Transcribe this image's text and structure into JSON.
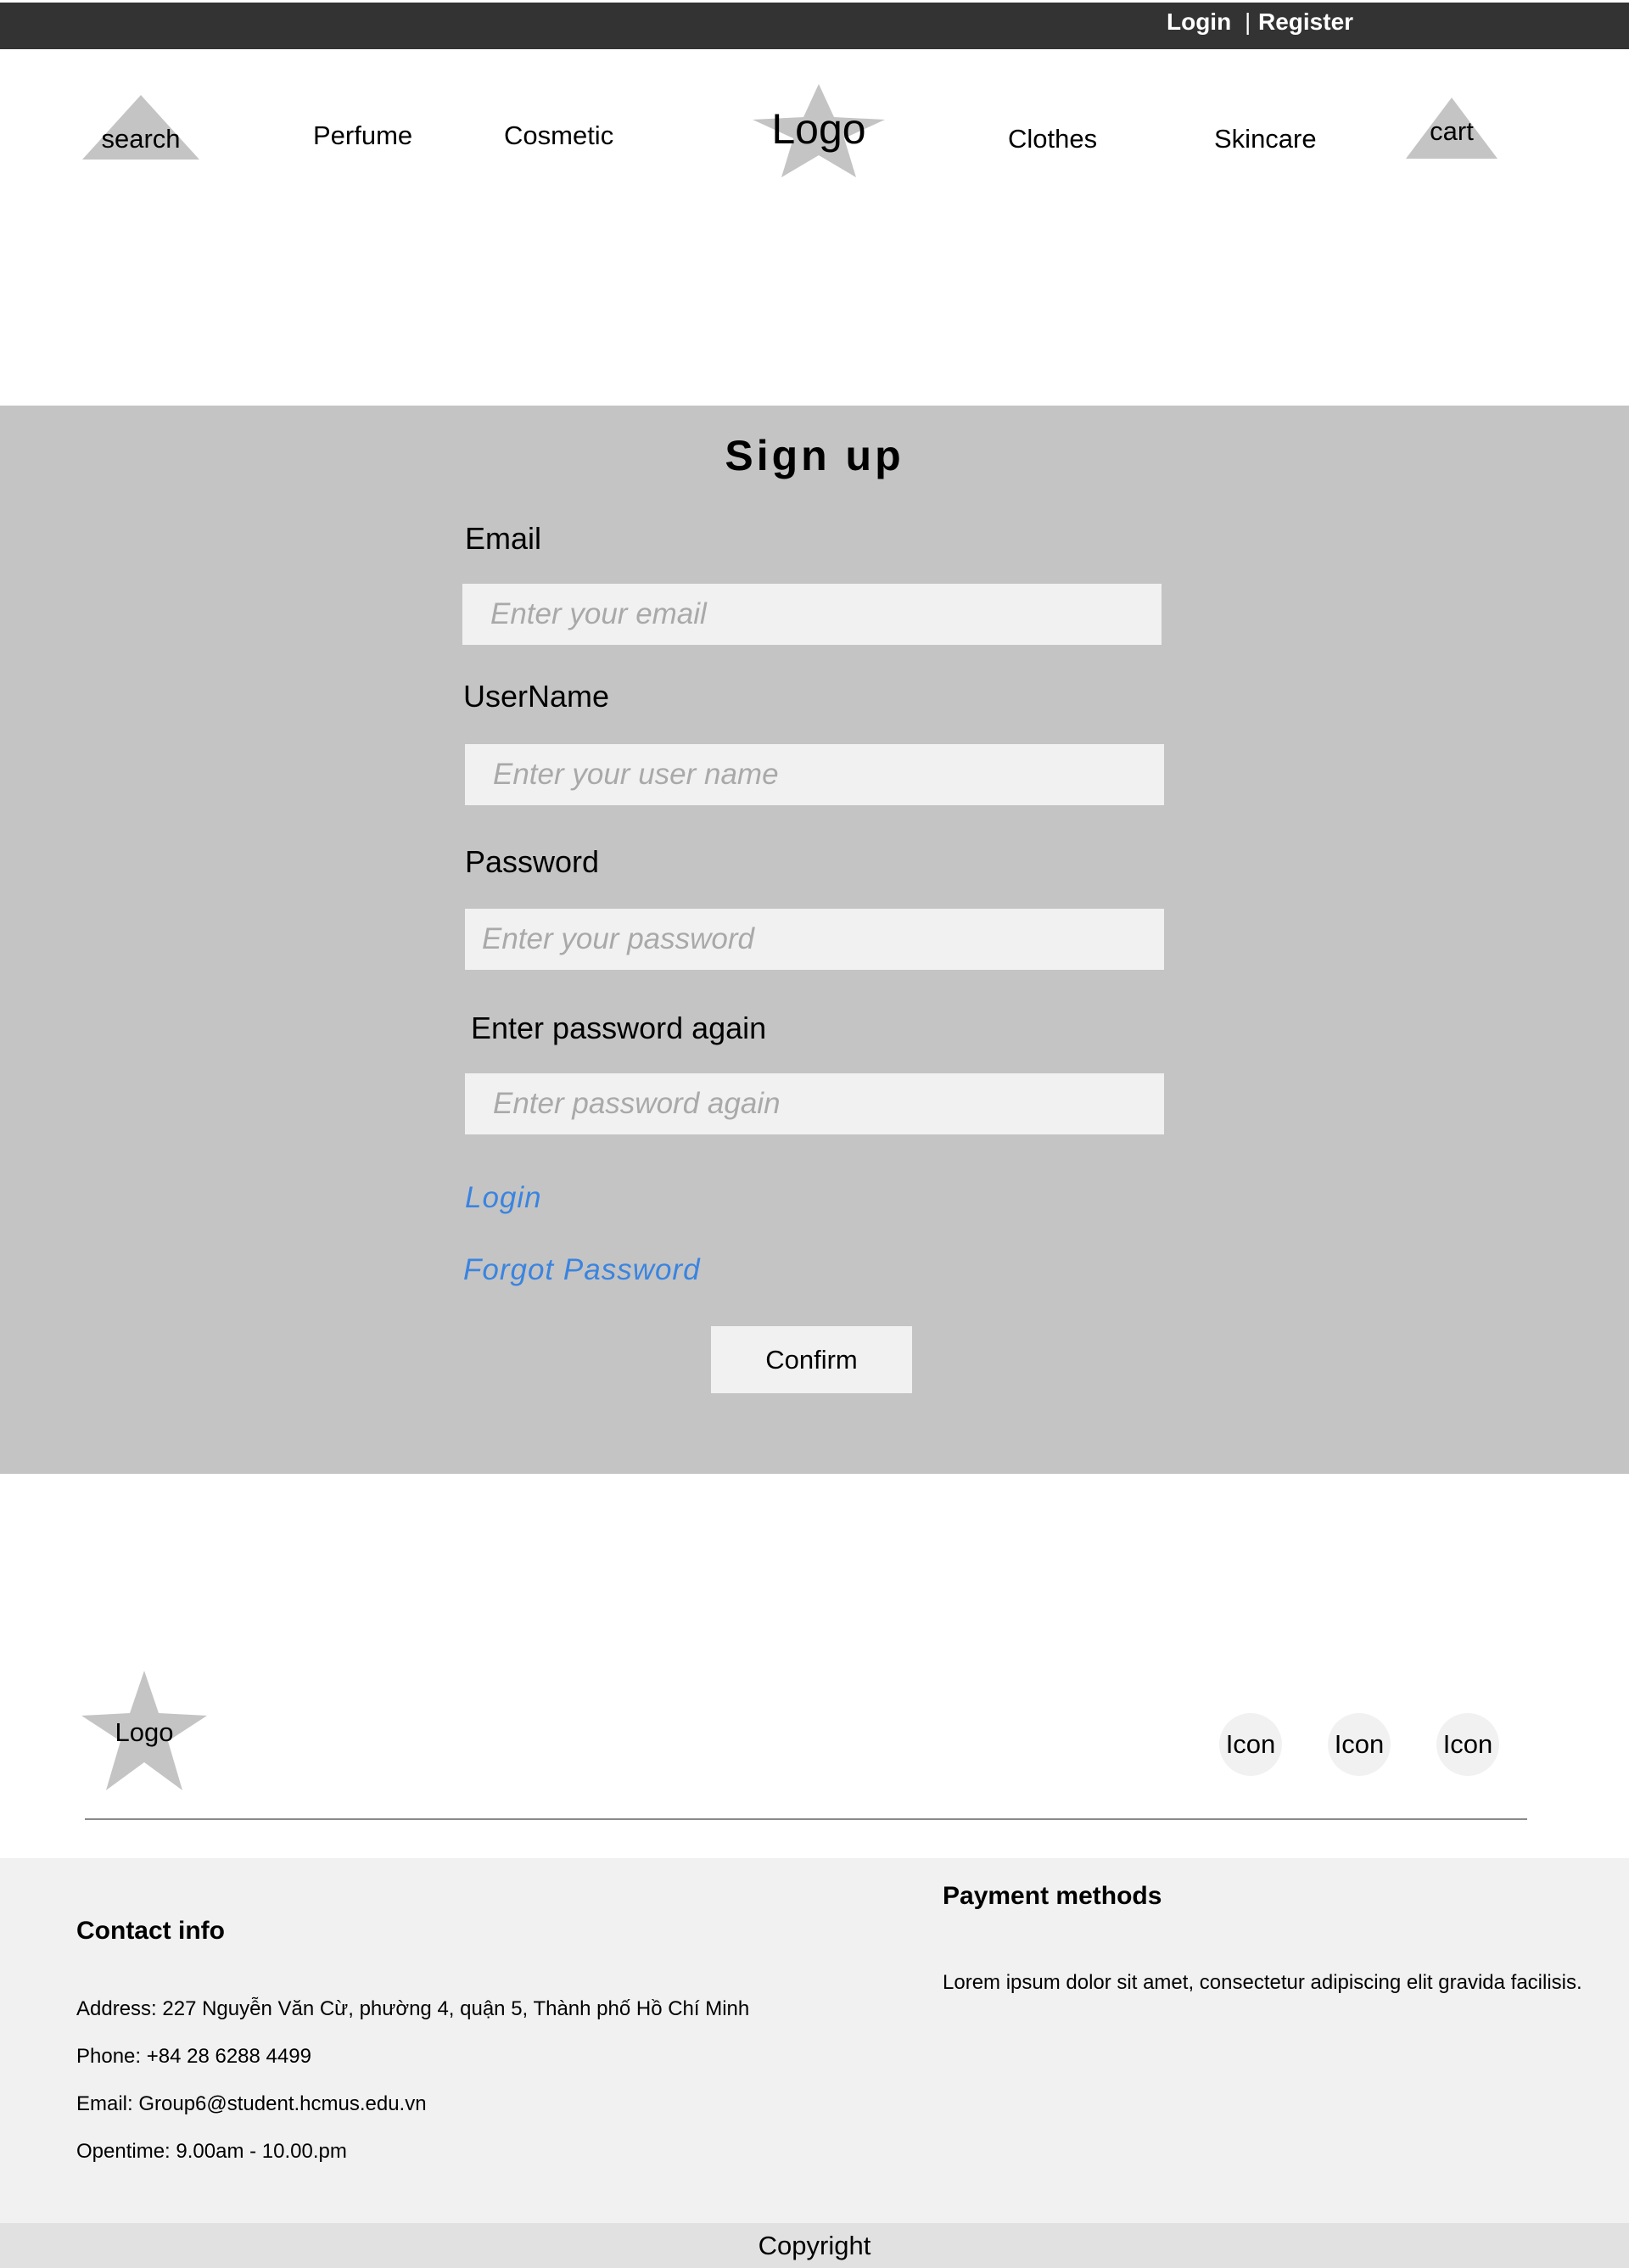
{
  "topbar": {
    "login": "Login",
    "separator": "|",
    "register": "Register"
  },
  "nav": {
    "search": "search",
    "items": [
      "Perfume",
      "Cosmetic",
      "Clothes",
      "Skincare"
    ],
    "logo": "Logo",
    "cart": "cart"
  },
  "signup": {
    "title": "Sign up",
    "fields": [
      {
        "label": "Email",
        "placeholder": "Enter your email"
      },
      {
        "label": "UserName",
        "placeholder": "Enter your user name"
      },
      {
        "label": "Password",
        "placeholder": "Enter your password"
      },
      {
        "label": "Enter password again",
        "placeholder": "Enter password again"
      }
    ],
    "login_link": "Login",
    "forgot_link": "Forgot Password",
    "confirm": "Confirm"
  },
  "footer": {
    "logo": "Logo",
    "icons": [
      "Icon",
      "Icon",
      "Icon"
    ],
    "contact": {
      "heading": "Contact info",
      "address": "Address: 227 Nguyễn Văn Cừ, phường 4, quận 5, Thành phố Hồ Chí Minh",
      "phone": "Phone: +84 28 6288 4499",
      "email": "Email: Group6@student.hcmus.edu.vn",
      "opentime": "Opentime: 9.00am - 10.00.pm"
    },
    "payment": {
      "heading": "Payment methods",
      "text": "Lorem ipsum dolor sit amet, consectetur adipiscing elit gravida facilisis."
    },
    "copyright": "Copyright"
  },
  "colors": {
    "topbar": "#333333",
    "panel": "#c4c4c4",
    "input": "#f1f1f1",
    "link": "#3a84e0",
    "shape": "#c4c4c4"
  }
}
